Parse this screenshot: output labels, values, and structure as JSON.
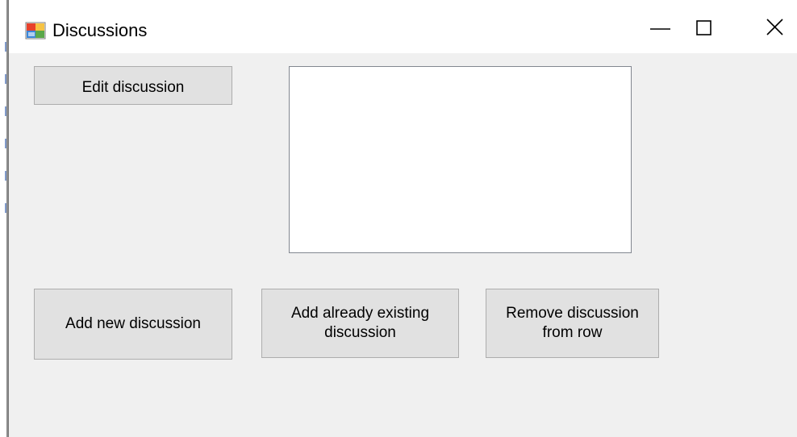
{
  "window": {
    "title": "Discussions",
    "icon": "winforms-app-icon"
  },
  "title_controls": {
    "minimize_icon": "minimize-icon",
    "maximize_icon": "maximize-icon",
    "close_icon": "close-icon"
  },
  "buttons": {
    "edit_discussion": "Edit discussion",
    "add_new_discussion": "Add new discussion",
    "add_existing_discussion": "Add already existing discussion",
    "remove_discussion_from_row": "Remove discussion from row"
  },
  "discussions_list": {
    "items": []
  },
  "colors": {
    "client_background": "#f0f0f0",
    "button_face": "#e1e1e1",
    "button_border": "#adadad",
    "list_border": "#828790"
  }
}
